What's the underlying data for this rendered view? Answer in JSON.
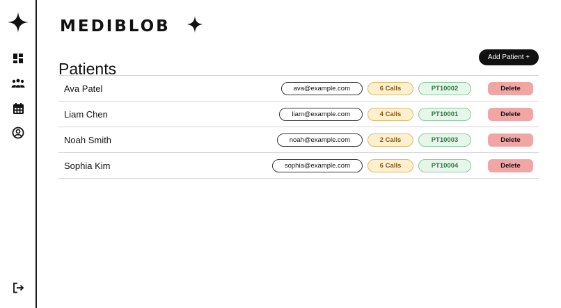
{
  "app": {
    "brand": "MEDIBLOB"
  },
  "page": {
    "title": "Patients",
    "add_button_label": "Add Patient +"
  },
  "sidebar": {
    "icons": [
      "star-logo-icon",
      "dashboard-icon",
      "patients-icon",
      "calendar-icon",
      "profile-icon",
      "logout-icon"
    ]
  },
  "patients": [
    {
      "name": "Ava Patel",
      "email": "ava@example.com",
      "calls": "6 Calls",
      "id": "PT10002",
      "action": "Delete"
    },
    {
      "name": "Liam Chen",
      "email": "liam@example.com",
      "calls": "4 Calls",
      "id": "PT10001",
      "action": "Delete"
    },
    {
      "name": "Noah Smith",
      "email": "noah@example.com",
      "calls": "2 Calls",
      "id": "PT10003",
      "action": "Delete"
    },
    {
      "name": "Sophia Kim",
      "email": "sophia@example.com",
      "calls": "6 Calls",
      "id": "PT10004",
      "action": "Delete"
    }
  ],
  "colors": {
    "calls_bg": "#fdf0cf",
    "calls_text": "#8a5a14",
    "id_bg": "#e6f6ea",
    "id_text": "#2f7a44",
    "delete_bg": "#f1a6a6"
  }
}
